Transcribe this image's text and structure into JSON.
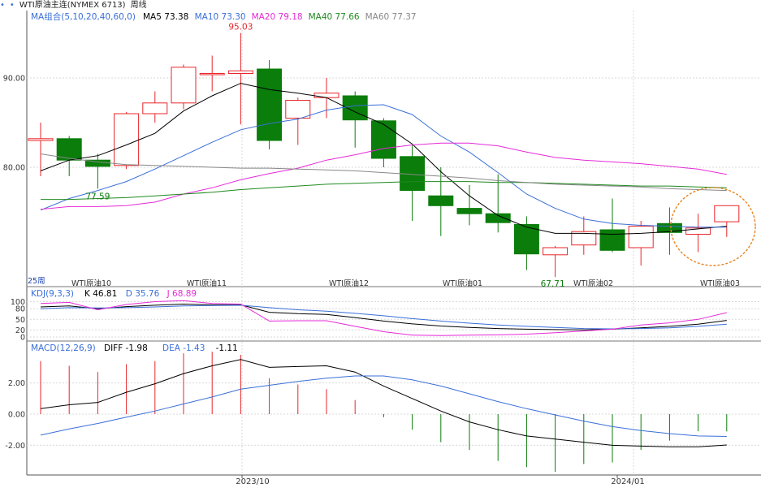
{
  "header": {
    "dot1": "•",
    "dot2": "•",
    "instrument": "WTI原油主连(NYMEX 6713)",
    "period": "周线"
  },
  "colors": {
    "up": "#e8262a",
    "down": "#0a7d0a",
    "ma5": "#000000",
    "ma10": "#3a6fd8",
    "ma20": "#e62ad8",
    "ma40": "#1f8a1f",
    "ma60": "#888888",
    "highlight_circle": "#e8821e",
    "grid": "#d9d9d9"
  },
  "labels": {
    "price_max": "95.03",
    "price_min_left": "77.59",
    "price_min_right": "67.71",
    "week_count": "25周",
    "month_tags": [
      "WTI原油10",
      "WTI原油11",
      "WTI原油12",
      "WTI原油01",
      "WTI原油02",
      "WTI原油03"
    ],
    "x_axis": [
      "2023/10",
      "2024/01"
    ]
  },
  "chart_data": [
    {
      "type": "candlestick",
      "title": "MA组合(5,10,20,40,60,0)",
      "legend": [
        {
          "name": "MA5",
          "value": "73.38"
        },
        {
          "name": "MA10",
          "value": "73.30"
        },
        {
          "name": "MA20",
          "value": "79.18"
        },
        {
          "name": "MA40",
          "value": "77.66"
        },
        {
          "name": "MA60",
          "value": "77.37"
        }
      ],
      "ylim": [
        67,
        96.5
      ],
      "yticks": [
        "90.00",
        "80.00"
      ],
      "yticks_values": [
        90,
        80
      ],
      "candles": [
        {
          "o": 83.0,
          "h": 85.0,
          "l": 79.0,
          "c": 83.2
        },
        {
          "o": 83.2,
          "h": 83.5,
          "l": 79.0,
          "c": 80.8
        },
        {
          "o": 80.8,
          "h": 81.5,
          "l": 77.6,
          "c": 80.1
        },
        {
          "o": 80.2,
          "h": 86.2,
          "l": 79.8,
          "c": 86.0
        },
        {
          "o": 86.0,
          "h": 88.5,
          "l": 85.0,
          "c": 87.2
        },
        {
          "o": 87.2,
          "h": 91.5,
          "l": 86.5,
          "c": 91.2
        },
        {
          "o": 90.4,
          "h": 92.5,
          "l": 88.5,
          "c": 90.5
        },
        {
          "o": 90.5,
          "h": 95.03,
          "l": 84.8,
          "c": 90.8
        },
        {
          "o": 91.0,
          "h": 92.0,
          "l": 82.0,
          "c": 83.0
        },
        {
          "o": 85.5,
          "h": 87.8,
          "l": 82.5,
          "c": 87.5
        },
        {
          "o": 87.8,
          "h": 90.0,
          "l": 85.5,
          "c": 88.3
        },
        {
          "o": 88.0,
          "h": 88.5,
          "l": 82.2,
          "c": 85.3
        },
        {
          "o": 85.2,
          "h": 85.5,
          "l": 80.0,
          "c": 81.0
        },
        {
          "o": 81.2,
          "h": 82.5,
          "l": 74.0,
          "c": 77.4
        },
        {
          "o": 76.8,
          "h": 80.0,
          "l": 72.3,
          "c": 75.7
        },
        {
          "o": 75.4,
          "h": 78.0,
          "l": 73.5,
          "c": 74.8
        },
        {
          "o": 74.8,
          "h": 79.2,
          "l": 72.7,
          "c": 73.8
        },
        {
          "o": 73.6,
          "h": 74.5,
          "l": 68.5,
          "c": 70.3
        },
        {
          "o": 70.2,
          "h": 71.2,
          "l": 67.71,
          "c": 71.0
        },
        {
          "o": 71.3,
          "h": 74.5,
          "l": 70.2,
          "c": 72.8
        },
        {
          "o": 73.0,
          "h": 76.5,
          "l": 70.5,
          "c": 70.7
        },
        {
          "o": 71.0,
          "h": 74.0,
          "l": 69.0,
          "c": 73.4
        },
        {
          "o": 73.7,
          "h": 75.5,
          "l": 70.2,
          "c": 72.7
        },
        {
          "o": 72.5,
          "h": 74.8,
          "l": 70.5,
          "c": 73.2
        },
        {
          "o": 73.9,
          "h": 75.7,
          "l": 72.2,
          "c": 75.7
        }
      ],
      "ma": [
        {
          "name": "MA5",
          "values": [
            79.6,
            80.8,
            81.3,
            82.5,
            83.8,
            86.3,
            88.0,
            89.4,
            88.7,
            88.3,
            87.8,
            86.2,
            84.8,
            82.6,
            79.5,
            76.8,
            74.6,
            73.3,
            72.6,
            72.6,
            72.5,
            72.6,
            72.8,
            73.1,
            73.4
          ]
        },
        {
          "name": "MA10",
          "values": [
            75.2,
            76.5,
            77.4,
            78.4,
            79.8,
            81.3,
            82.8,
            84.2,
            84.9,
            85.4,
            86.4,
            86.9,
            87.0,
            85.9,
            83.5,
            81.7,
            79.4,
            77.0,
            75.4,
            74.2,
            73.7,
            73.5,
            73.4,
            73.3,
            73.3
          ]
        },
        {
          "name": "MA20",
          "values": [
            75.3,
            75.6,
            75.6,
            75.7,
            76.1,
            77.0,
            77.7,
            78.6,
            79.3,
            79.9,
            80.8,
            81.4,
            82.1,
            82.5,
            82.7,
            82.7,
            82.4,
            81.7,
            81.1,
            80.8,
            80.6,
            80.4,
            80.1,
            79.8,
            79.2
          ]
        },
        {
          "name": "MA40",
          "values": [
            76.4,
            76.4,
            76.5,
            76.6,
            76.8,
            77.0,
            77.2,
            77.5,
            77.7,
            77.9,
            78.1,
            78.2,
            78.3,
            78.4,
            78.4,
            78.4,
            78.3,
            78.3,
            78.2,
            78.1,
            78.0,
            77.9,
            77.9,
            77.8,
            77.7
          ]
        },
        {
          "name": "MA60",
          "values": [
            81.5,
            81.0,
            80.6,
            80.3,
            80.2,
            80.1,
            80.0,
            79.9,
            79.9,
            79.8,
            79.7,
            79.6,
            79.4,
            79.2,
            79.0,
            78.8,
            78.5,
            78.3,
            78.1,
            78.0,
            77.9,
            77.8,
            77.6,
            77.5,
            77.4
          ]
        }
      ]
    },
    {
      "type": "line",
      "title": "KDJ(9,3,3)",
      "legend": [
        {
          "name": "K",
          "value": "46.81"
        },
        {
          "name": "D",
          "value": "35.76"
        },
        {
          "name": "J",
          "value": "68.89"
        }
      ],
      "ylim": [
        -5,
        110
      ],
      "yticks": [
        "100",
        "80",
        "50",
        "20",
        "0"
      ],
      "yticks_values": [
        100,
        80,
        50,
        20,
        0
      ],
      "series": [
        {
          "name": "K",
          "values": [
            85,
            88,
            80,
            86,
            90,
            93,
            91,
            91,
            70,
            66,
            64,
            55,
            45,
            37,
            31,
            27,
            24,
            22,
            21,
            20,
            22,
            26,
            30,
            36,
            47
          ]
        },
        {
          "name": "D",
          "values": [
            80,
            83,
            82,
            83,
            85,
            88,
            89,
            90,
            83,
            77,
            73,
            67,
            60,
            52,
            45,
            39,
            34,
            30,
            27,
            24,
            23,
            24,
            26,
            30,
            36
          ]
        },
        {
          "name": "J",
          "values": [
            95,
            98,
            77,
            92,
            100,
            103,
            95,
            93,
            45,
            46,
            46,
            30,
            15,
            5,
            4,
            5,
            6,
            8,
            12,
            17,
            22,
            34,
            40,
            50,
            69
          ]
        }
      ]
    },
    {
      "type": "bar+line",
      "title": "MACD(12,26,9)",
      "legend": [
        {
          "name": "DIFF",
          "value": "-1.98"
        },
        {
          "name": "DEA",
          "value": "-1.43"
        },
        {
          "name": "",
          "value": "-1.11"
        }
      ],
      "ylim": [
        -3.8,
        3.8
      ],
      "yticks": [
        "2.00",
        "0.00",
        "-2.00"
      ],
      "yticks_values": [
        2,
        0,
        -2
      ],
      "series": [
        {
          "name": "DIFF",
          "values": [
            0.35,
            0.6,
            0.75,
            1.4,
            1.95,
            2.6,
            3.1,
            3.5,
            3.0,
            3.05,
            3.1,
            2.7,
            1.8,
            1.0,
            0.2,
            -0.5,
            -1.0,
            -1.4,
            -1.6,
            -1.8,
            -2.0,
            -2.05,
            -2.1,
            -2.1,
            -1.98
          ]
        },
        {
          "name": "DEA",
          "values": [
            -1.35,
            -0.95,
            -0.6,
            -0.2,
            0.2,
            0.65,
            1.1,
            1.6,
            1.85,
            2.1,
            2.3,
            2.45,
            2.45,
            2.2,
            1.8,
            1.3,
            0.8,
            0.35,
            -0.05,
            -0.45,
            -0.8,
            -1.05,
            -1.25,
            -1.4,
            -1.43
          ]
        },
        {
          "name": "MACD",
          "values": [
            3.4,
            3.1,
            2.7,
            3.2,
            3.4,
            3.9,
            4.0,
            3.8,
            2.3,
            1.9,
            1.6,
            0.9,
            -0.2,
            -1.0,
            -1.8,
            -2.3,
            -3.0,
            -3.4,
            -3.7,
            -3.2,
            -3.1,
            -2.3,
            -1.7,
            -1.1,
            -1.11
          ]
        }
      ]
    }
  ]
}
